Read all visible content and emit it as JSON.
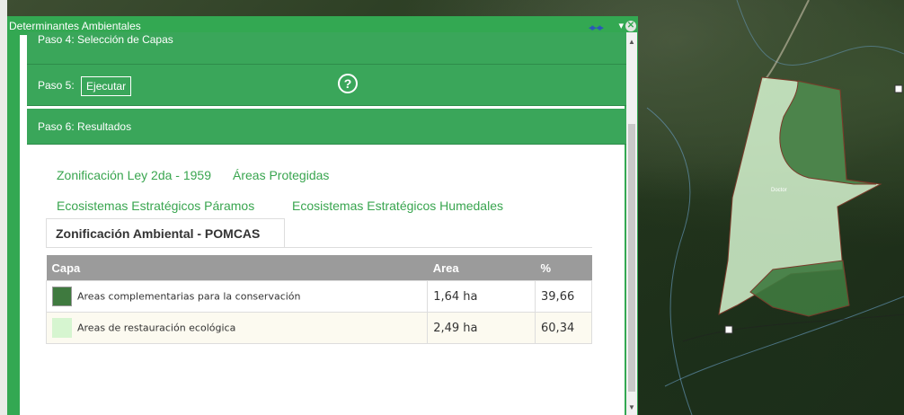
{
  "window": {
    "title": "Determinantes Ambientales"
  },
  "steps": {
    "step4_label": "Paso 4: Selección de Capas",
    "step5_label": "Paso 5:",
    "execute_label": "Ejecutar",
    "help_glyph": "?",
    "step6_label": "Paso 6: Resultados"
  },
  "tabs": {
    "links": [
      "Zonificación Ley 2da - 1959",
      "Áreas Protegidas",
      "Ecosistemas Estratégicos Páramos",
      "Ecosistemas Estratégicos Humedales"
    ],
    "active": "Zonificación Ambiental - POMCAS"
  },
  "table": {
    "headers": [
      "Capa",
      "Area",
      "%"
    ],
    "rows": [
      {
        "label": "Areas complementarias para la conservación",
        "area": "1,64 ha",
        "pct": "39,66",
        "color": "#3f7a3f"
      },
      {
        "label": "Areas de restauración ecológica",
        "area": "2,49 ha",
        "pct": "60,34",
        "color": "#d6f5d0"
      }
    ]
  },
  "map": {
    "parcel_label": "Doctor"
  },
  "icons": {
    "help": "help-circle-icon",
    "close": "close-icon",
    "minimize": "minimize-icon",
    "resize": "resize-arrows-icon"
  }
}
